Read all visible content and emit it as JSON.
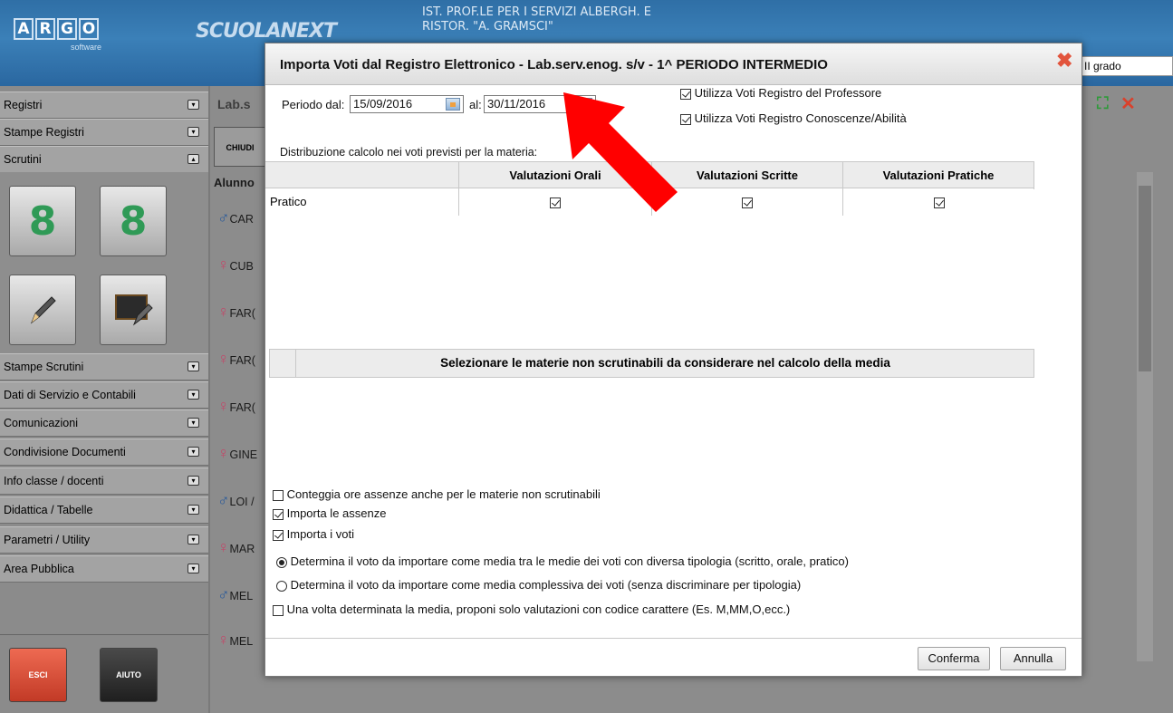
{
  "app": {
    "logo_letters": [
      "A",
      "R",
      "G",
      "O"
    ],
    "logo_sub": "software",
    "product": "SCUOLANEXT",
    "school_line1": "IST. PROF.LE PER I SERVIZI ALBERGH. E",
    "school_line2": "RISTOR. \"A. GRAMSCI\"",
    "grade_select": "II grado"
  },
  "sidebar": {
    "top_items": [
      {
        "label": "Registri"
      },
      {
        "label": "Stampe Registri"
      },
      {
        "label": "Scrutini"
      }
    ],
    "items": [
      {
        "label": "Stampe Scrutini"
      },
      {
        "label": "Dati di Servizio e Contabili"
      },
      {
        "label": "Comunicazioni"
      },
      {
        "label": "Condivisione Documenti"
      },
      {
        "label": "Info classe / docenti"
      },
      {
        "label": "Didattica / Tabelle"
      },
      {
        "label": "Parametri / Utility"
      },
      {
        "label": "Area Pubblica"
      }
    ],
    "esci": "ESCI",
    "aiuto": "AIUTO"
  },
  "background": {
    "header": "Lab.s",
    "chiudi": "CHIUDI",
    "alunno": "Alunno",
    "students": [
      {
        "g": "m",
        "name": "CAR"
      },
      {
        "g": "f",
        "name": "CUB"
      },
      {
        "g": "f",
        "name": "FAR("
      },
      {
        "g": "f",
        "name": "FAR("
      },
      {
        "g": "f",
        "name": "FAR("
      },
      {
        "g": "f",
        "name": "GINE"
      },
      {
        "g": "m",
        "name": "LOI /"
      },
      {
        "g": "f",
        "name": "MAR"
      },
      {
        "g": "m",
        "name": "MEL"
      },
      {
        "g": "f",
        "name": "MEL"
      }
    ]
  },
  "dialog": {
    "title": "Importa Voti dal Registro Elettronico - Lab.serv.enog. s/v - 1^ PERIODO INTERMEDIO",
    "periodo_label": "Periodo dal:",
    "date_from": "15/09/2016",
    "al_label": "al:",
    "date_to": "30/11/2016",
    "opt_registro_prof": "Utilizza Voti Registro del Professore",
    "opt_registro_con": "Utilizza Voti Registro Conoscenze/Abilità",
    "distribuzione_label": "Distribuzione calcolo nei voti previsti per la materia:",
    "columns": [
      "Valutazioni Orali",
      "Valutazioni Scritte",
      "Valutazioni Pratiche"
    ],
    "rows": [
      {
        "label": "Pratico",
        "orali": true,
        "scritte": true,
        "pratiche": true
      }
    ],
    "materie_header": "Selezionare le materie non scrutinabili da considerare nel calcolo della media",
    "options": {
      "conteggia": "Conteggia ore assenze anche per le materie non scrutinabili",
      "importa_assenze": "Importa le assenze",
      "importa_voti": "Importa i voti",
      "media_tipologia": "Determina il voto da importare come media tra le medie dei voti con diversa tipologia (scritto, orale, pratico)",
      "media_complessiva": "Determina il voto da importare come media complessiva dei voti (senza discriminare per tipologia)",
      "solo_carattere": "Una volta determinata la media, proponi solo valutazioni con codice carattere (Es. M,MM,O,ecc.)"
    },
    "conferma": "Conferma",
    "annulla": "Annulla"
  },
  "colors": {
    "accent_red": "#ff0000",
    "banner_blue": "#3b80b8",
    "close_orange": "#e2543c"
  }
}
